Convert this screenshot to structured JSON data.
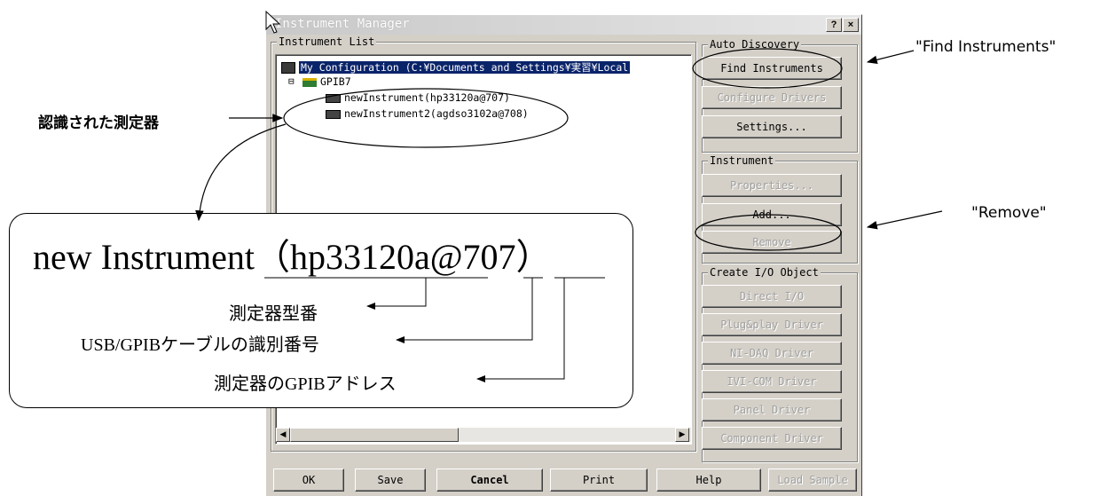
{
  "window": {
    "title": "Instrument Manager",
    "help_btn": "?",
    "close_btn": "×"
  },
  "instrument_list": {
    "group_label": "Instrument List",
    "root": "My Configuration (C:¥Documents and Settings¥実習¥Local",
    "gpib": "GPIB7",
    "items": [
      "newInstrument(hp33120a@707)",
      "newInstrument2(agdso3102a@708)"
    ]
  },
  "auto_discovery": {
    "label": "Auto Discovery",
    "find": "Find Instruments",
    "configure": "Configure Drivers",
    "settings": "Settings..."
  },
  "instrument": {
    "label": "Instrument",
    "properties": "Properties...",
    "add": "Add...",
    "remove": "Remove"
  },
  "create_io": {
    "label": "Create I/O Object",
    "buttons": [
      "Direct I/O",
      "Plug&play Driver",
      "NI-DAQ Driver",
      "IVI-COM Driver",
      "Panel Driver",
      "Component Driver"
    ]
  },
  "bottom": {
    "ok": "OK",
    "save": "Save",
    "cancel": "Cancel",
    "print": "Print",
    "help": "Help",
    "load_sample": "Load Sample"
  },
  "annotations": {
    "recognized": "認識された測定器",
    "find_label": "\"Find Instruments\"",
    "remove_label": "\"Remove\"",
    "big_text": "new Instrument（hp33120a@707）",
    "model": "測定器型番",
    "usb_gpib": "USB/GPIBケーブルの識別番号",
    "address": "測定器のGPIBアドレス"
  }
}
